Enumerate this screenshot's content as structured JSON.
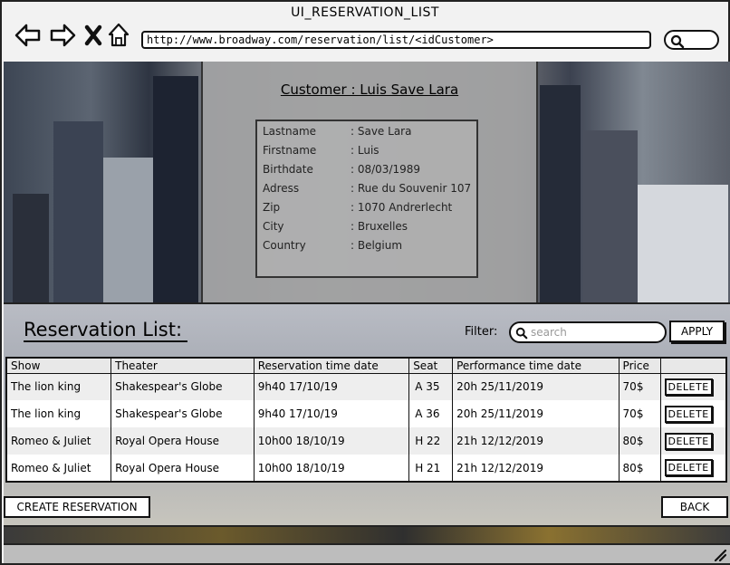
{
  "window": {
    "title": "UI_RESERVATION_LIST",
    "url": "http://www.broadway.com/reservation/list/<idCustomer>"
  },
  "nav": {
    "icons": [
      "back-arrow-icon",
      "forward-arrow-icon",
      "close-icon",
      "home-icon",
      "search-icon"
    ]
  },
  "customer": {
    "title": "Customer : Luis Save Lara",
    "fields": [
      {
        "label": "Lastname",
        "value": ": Save Lara"
      },
      {
        "label": "Firstname",
        "value": ": Luis"
      },
      {
        "label": "Birthdate",
        "value": ": 08/03/1989"
      },
      {
        "label": "Adress",
        "value": ": Rue du Souvenir 107"
      },
      {
        "label": "Zip",
        "value": ": 1070 Andrerlecht"
      },
      {
        "label": "City",
        "value": ": Bruxelles"
      },
      {
        "label": "Country",
        "value": ": Belgium"
      }
    ]
  },
  "reservations": {
    "title": "Reservation List:",
    "filter_label": "Filter:",
    "filter_placeholder": "search",
    "apply_label": "APPLY",
    "columns": [
      "Show",
      "Theater",
      "Reservation time date",
      "Seat",
      "Performance time date",
      "Price",
      ""
    ],
    "rows": [
      {
        "show": "The lion king",
        "theater": "Shakespear's Globe",
        "reservation": "9h40 17/10/19",
        "seat": "A 35",
        "performance": "20h 25/11/2019",
        "price": "70$",
        "action": "DELETE"
      },
      {
        "show": "The lion king",
        "theater": "Shakespear's Globe",
        "reservation": "9h40 17/10/19",
        "seat": "A 36",
        "performance": "20h 25/11/2019",
        "price": "70$",
        "action": "DELETE"
      },
      {
        "show": "Romeo & Juliet",
        "theater": "Royal Opera House",
        "reservation": "10h00 18/10/19",
        "seat": "H 22",
        "performance": "21h 12/12/2019",
        "price": "80$",
        "action": "DELETE"
      },
      {
        "show": "Romeo & Juliet",
        "theater": "Royal Opera House",
        "reservation": "10h00 18/10/19",
        "seat": "H 21",
        "performance": "21h 12/12/2019",
        "price": "80$",
        "action": "DELETE"
      }
    ],
    "create_label": "CREATE RESERVATION",
    "back_label": "BACK"
  }
}
